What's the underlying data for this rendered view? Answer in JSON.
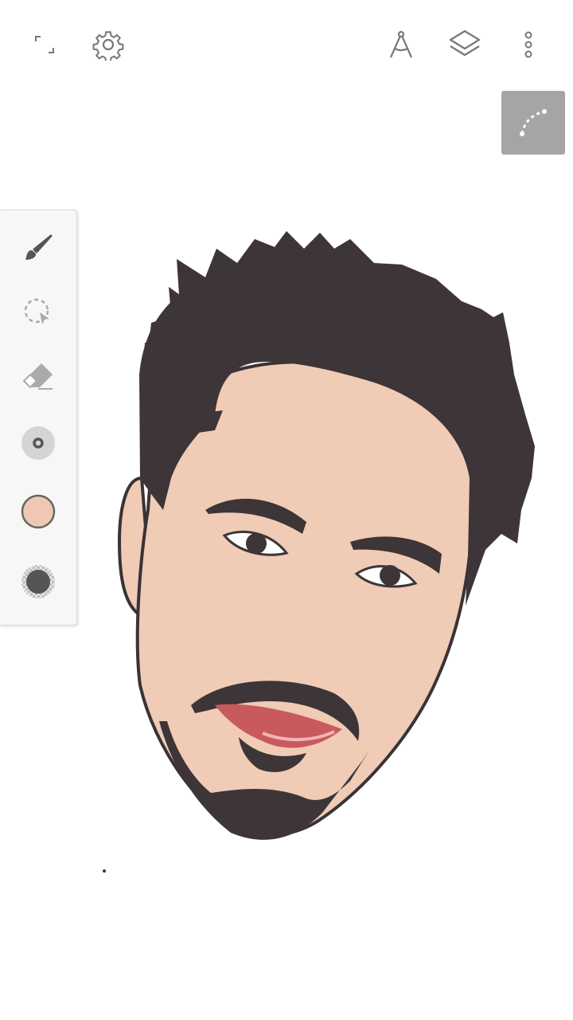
{
  "app": {
    "accent": "#555555",
    "icon_color": "#777777",
    "toolbox_background": "#f7f7f7",
    "curve_button_background": "#a5a5a5"
  },
  "toolbar": {
    "left": [
      {
        "name": "fullscreen-icon"
      },
      {
        "name": "settings-gear-icon"
      }
    ],
    "right": [
      {
        "name": "drafting-compass-icon"
      },
      {
        "name": "layers-icon"
      },
      {
        "name": "more-vertical-icon"
      }
    ]
  },
  "curve_tool": {
    "icon": "bezier-curve-icon"
  },
  "tools": [
    {
      "name": "brush-icon",
      "selected": true
    },
    {
      "name": "lasso-select-icon",
      "selected": false
    },
    {
      "name": "eraser-icon",
      "selected": false
    },
    {
      "name": "brush-size-icon",
      "selected": false
    },
    {
      "name": "color-swatch",
      "color": "#f0c8b2"
    },
    {
      "name": "opacity-swatch",
      "color": "#555555"
    }
  ],
  "canvas": {
    "skin_color": "#f0cbb6",
    "hair_color": "#3d3537",
    "lip_color": "#c85a5e",
    "outline_color": "#3a3336"
  }
}
